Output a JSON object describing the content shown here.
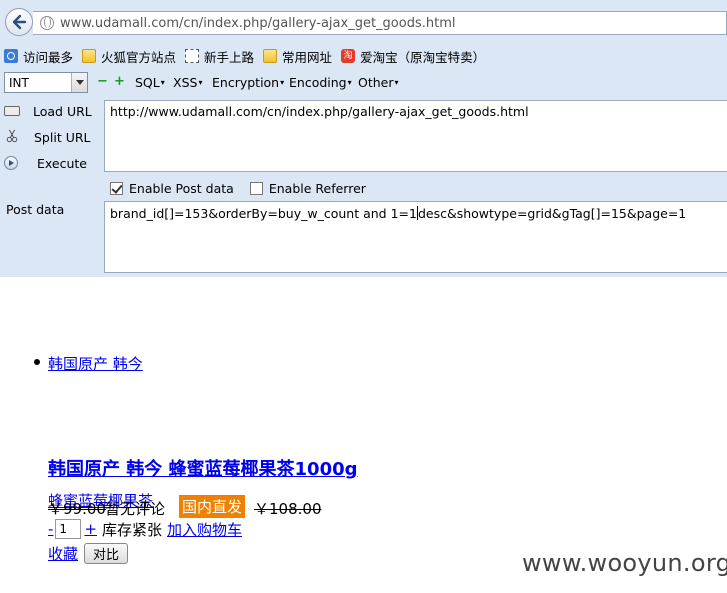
{
  "browser": {
    "url": "www.udamall.com/cn/index.php/gallery-ajax_get_goods.html",
    "bookmarks": [
      {
        "label": "访问最多",
        "icon": "most-visited-icon"
      },
      {
        "label": "火狐官方站点",
        "icon": "folder-icon"
      },
      {
        "label": "新手上路",
        "icon": "page-icon"
      },
      {
        "label": "常用网址",
        "icon": "folder-icon"
      },
      {
        "label": "爱淘宝（原淘宝特卖）",
        "icon": "taobao-icon",
        "badge": "淘"
      }
    ]
  },
  "hackbar": {
    "select_value": "INT",
    "minus": "−",
    "plus": "+",
    "menus": [
      "SQL",
      "XSS",
      "Encryption",
      "Encoding",
      "Other"
    ],
    "load_url_label": "Load URL",
    "split_url_label": "Split URL",
    "execute_label": "Execute",
    "url_value": "http://www.udamall.com/cn/index.php/gallery-ajax_get_goods.html",
    "enable_post_label": "Enable Post data",
    "enable_post_checked": true,
    "enable_referrer_label": "Enable Referrer",
    "enable_referrer_checked": false,
    "post_label": "Post data",
    "post_before_caret": "brand_id[]=153&orderBy=buy_w_count  and 1=1",
    "post_after_caret": "desc&showtype=grid&gTag[]=15&page=1"
  },
  "page": {
    "bullet_link": "韩国原产 韩今",
    "product_title": "韩国原产 韩今 蜂蜜蓝莓椰果茶1000g",
    "sub_name": "蜂蜜蓝莓椰果茶",
    "price": "￥99.00",
    "comments": "暂无评论",
    "badge": "国内直发",
    "old_price": "￥108.00",
    "qty_minus": "-",
    "qty_value": "1",
    "qty_plus": "+",
    "stock": "库存紧张",
    "add_cart": "加入购物车",
    "favorite": "收藏",
    "compare": "对比"
  },
  "watermark": "www.wooyun.org"
}
